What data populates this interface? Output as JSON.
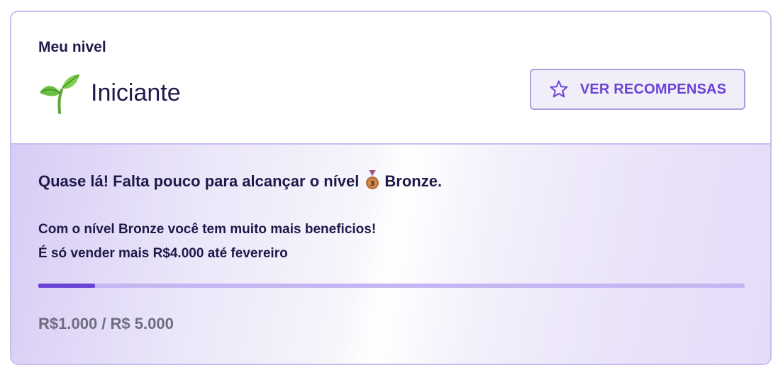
{
  "header": {
    "caption": "Meu nivel",
    "level_name": "Iniciante",
    "level_icon": "sprout-icon",
    "rewards_button_label": "VER RECOMPENSAS",
    "rewards_button_icon": "star-icon"
  },
  "progress": {
    "headline_prefix": "Quase lá! Falta pouco para alcançar o nível",
    "next_level_icon": "bronze-medal-icon",
    "next_level_name": "Bronze",
    "headline_suffix": ".",
    "description_line1": "Com o nível Bronze você tem muito mais beneficios!",
    "description_line2": "É só vender mais R$4.000 até fevereiro",
    "progress_fraction": 0.08,
    "amount_text": "R$1.000 / R$ 5.000"
  },
  "colors": {
    "accent": "#6a42d6",
    "border": "#c9bdf1",
    "text_dark": "#1e1a4a",
    "text_muted": "#6f6b80",
    "track": "#c4b6f2"
  }
}
